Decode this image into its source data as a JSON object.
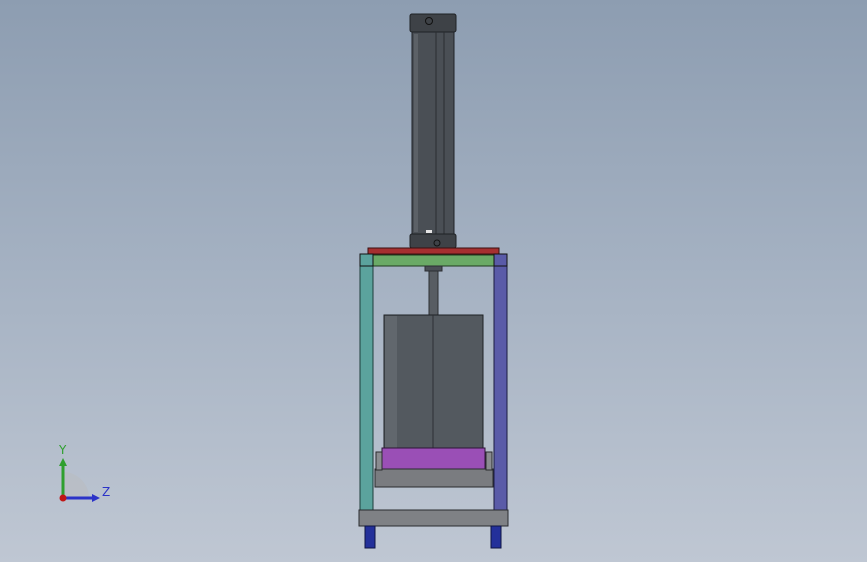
{
  "viewport": {
    "background_top": "#8d9db1",
    "background_bottom": "#bfc7d3"
  },
  "model": {
    "cylinder_color": "#4a4f55",
    "tank_color": "#53595f",
    "frame_left_color": "#5ba39d",
    "frame_right_color": "#5a5ba8",
    "top_beam_color": "#6aaa66",
    "plate_color": "#9a4fb6",
    "base_color": "#7a7c80",
    "feet_color": "#23309a"
  },
  "triad": {
    "y_label": "Y",
    "z_label": "Z",
    "y_color": "#2e9f2e",
    "z_color": "#2b33c8",
    "x_color": "#c01616"
  }
}
